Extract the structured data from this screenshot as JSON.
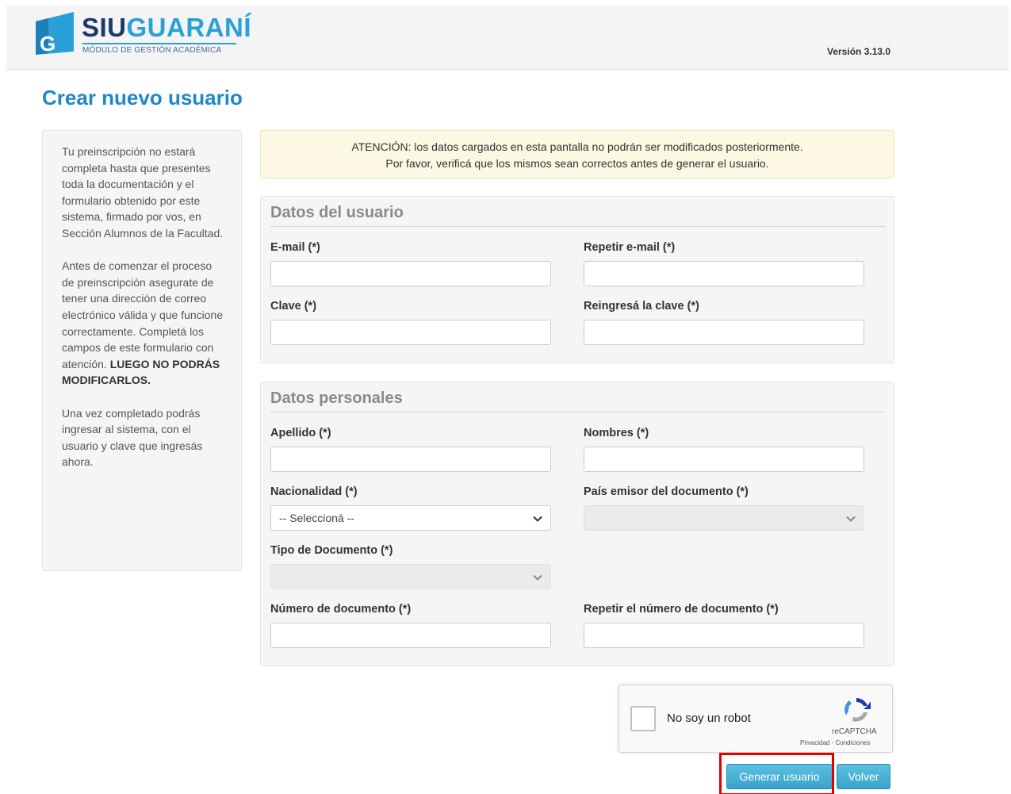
{
  "header": {
    "brand_part1": "SIU",
    "brand_part2": "GUARANÍ",
    "subtitle": "MÓDULO DE GESTIÓN ACADÉMICA",
    "version": "Versión 3.13.0"
  },
  "page_title": "Crear nuevo usuario",
  "sidebar": {
    "paragraph1": "Tu preinscripción no estará completa hasta que presentes toda la documentación y el formulario obtenido por este sistema, firmado por vos, en Sección Alumnos de la Facultad.",
    "paragraph2_text": "Antes de comenzar el proceso de preinscripción asegurate de tener una dirección de correo electrónico válida y que funcione correctamente. Completá los campos de este formulario con atención.",
    "paragraph2_bold": "LUEGO NO PODRÁS MODIFICARLOS.",
    "paragraph3": "Una vez completado podrás ingresar al sistema, con el usuario y clave que ingresás ahora."
  },
  "alert": {
    "line1": "ATENCIÓN: los datos cargados en esta pantalla no podrán ser modificados posteriormente.",
    "line2": "Por favor, verificá que los mismos sean correctos antes de generar el usuario."
  },
  "user_section": {
    "legend": "Datos del usuario",
    "email_label": "E-mail (*)",
    "email_value": "",
    "repeat_email_label": "Repetir e-mail (*)",
    "repeat_email_value": "",
    "password_label": "Clave (*)",
    "password_value": "",
    "repeat_password_label": "Reingresá la clave (*)",
    "repeat_password_value": ""
  },
  "personal_section": {
    "legend": "Datos personales",
    "lastname_label": "Apellido (*)",
    "lastname_value": "",
    "firstname_label": "Nombres (*)",
    "firstname_value": "",
    "nationality_label": "Nacionalidad (*)",
    "nationality_selected": "-- Seleccioná --",
    "issuer_country_label": "País emisor del documento (*)",
    "issuer_country_selected": "",
    "doc_type_label": "Tipo de Documento (*)",
    "doc_type_selected": "",
    "doc_number_label": "Número de documento (*)",
    "doc_number_value": "",
    "repeat_doc_number_label": "Repetir el número de documento (*)",
    "repeat_doc_number_value": ""
  },
  "captcha": {
    "checkbox_label": "No soy un robot",
    "brand": "reCAPTCHA",
    "links": "Privacidad - Condiciones"
  },
  "buttons": {
    "generate": "Generar usuario",
    "back": "Volver"
  },
  "colors": {
    "brand_dark": "#1b3a6b",
    "brand_light": "#2aa0d8",
    "title": "#1f88c6",
    "alert_bg": "#fcf8e3",
    "button": "#3aa3cc",
    "highlight": "#e00000"
  }
}
